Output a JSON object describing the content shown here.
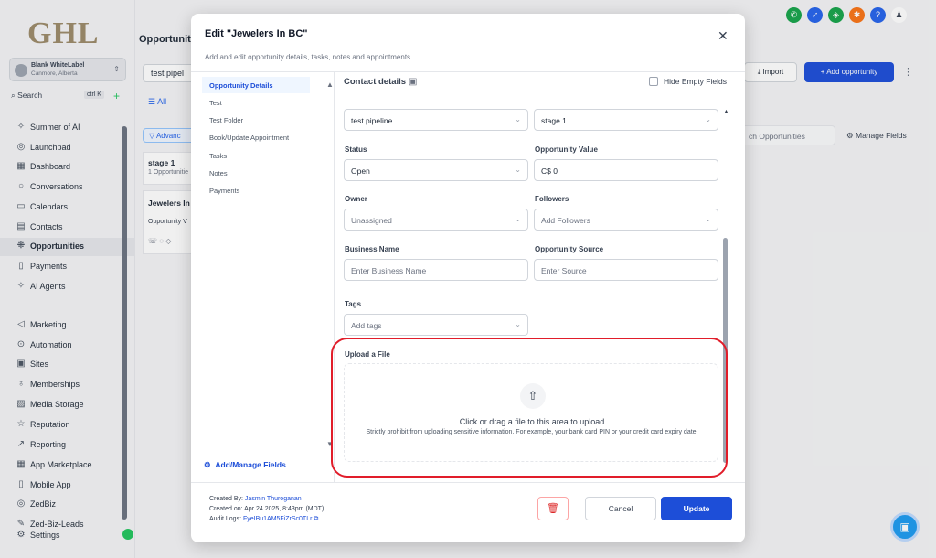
{
  "sidebar": {
    "logo": "GHL",
    "account_name": "Blank WhiteLabel",
    "account_location": "Canmore, Alberta",
    "search_label": "Search",
    "search_shortcut": "ctrl K",
    "items": [
      {
        "label": "Summer of AI",
        "icon": "sparkle-icon"
      },
      {
        "label": "Launchpad",
        "icon": "rocket-icon"
      },
      {
        "label": "Dashboard",
        "icon": "grid-icon"
      },
      {
        "label": "Conversations",
        "icon": "chat-icon"
      },
      {
        "label": "Calendars",
        "icon": "calendar-icon"
      },
      {
        "label": "Contacts",
        "icon": "contacts-icon"
      },
      {
        "label": "Opportunities",
        "icon": "funnel-icon"
      },
      {
        "label": "Payments",
        "icon": "payments-icon"
      },
      {
        "label": "AI Agents",
        "icon": "ai-icon"
      },
      {
        "label": "Marketing",
        "icon": "send-icon"
      },
      {
        "label": "Automation",
        "icon": "automation-icon"
      },
      {
        "label": "Sites",
        "icon": "sites-icon"
      },
      {
        "label": "Memberships",
        "icon": "memberships-icon"
      },
      {
        "label": "Media Storage",
        "icon": "media-icon"
      },
      {
        "label": "Reputation",
        "icon": "star-icon"
      },
      {
        "label": "Reporting",
        "icon": "chart-icon"
      },
      {
        "label": "App Marketplace",
        "icon": "apps-icon"
      },
      {
        "label": "Mobile App",
        "icon": "mobile-icon"
      },
      {
        "label": "ZedBiz",
        "icon": "zedbiz-icon"
      },
      {
        "label": "Zed-Biz-Leads",
        "icon": "leads-icon"
      },
      {
        "label": "Settings",
        "icon": "gear-icon"
      }
    ]
  },
  "background": {
    "title": "Opportunitie",
    "pipeline_select": "test pipel",
    "tab_all": "All",
    "advanced": "Advanc",
    "stage_title": "stage 1",
    "stage_count": "1 Opportunitie",
    "card_title": "Jewelers In",
    "card_sub": "Opportunity V",
    "import_label": "Import",
    "add_opportunity_label": "+ Add opportunity",
    "search_placeholder": "ch Opportunities",
    "manage_fields_label": "Manage Fields"
  },
  "modal": {
    "title": "Edit \"Jewelers In BC\"",
    "subtitle": "Add and edit opportunity details, tasks, notes and appointments.",
    "left_nav": [
      "Opportunity Details",
      "Test",
      "Test Folder",
      "Book/Update Appointment",
      "Tasks",
      "Notes",
      "Payments"
    ],
    "add_manage_fields": "Add/Manage Fields",
    "contact_details": "Contact details",
    "hide_empty_fields": "Hide Empty Fields",
    "pipeline_value": "test pipeline",
    "stage_value": "stage 1",
    "status_label": "Status",
    "status_value": "Open",
    "opp_value_label": "Opportunity Value",
    "opp_value": "C$ 0",
    "owner_label": "Owner",
    "owner_placeholder": "Unassigned",
    "followers_label": "Followers",
    "followers_placeholder": "Add Followers",
    "business_name_label": "Business Name",
    "business_name_placeholder": "Enter Business Name",
    "opp_source_label": "Opportunity Source",
    "opp_source_placeholder": "Enter Source",
    "tags_label": "Tags",
    "tags_placeholder": "Add tags",
    "upload_label": "Upload a File",
    "upload_main": "Click or drag a file to this area to upload",
    "upload_note": "Strictly prohibit from uploading sensitive information. For example, your bank card PIN or your credit card expiry date.",
    "created_by_prefix": "Created By: ",
    "created_by": "Jasmin Thuroganan",
    "created_on": "Created on: Apr 24 2025, 8:43pm (MDT)",
    "audit_prefix": "Audit Logs: ",
    "audit_id": "FyeIBu1AM5FiZrSc0TLr",
    "cancel": "Cancel",
    "update": "Update"
  },
  "colors": {
    "primary": "#1d4ed8",
    "highlight_ring": "#e11d2a",
    "logo": "#9c8a6a"
  }
}
